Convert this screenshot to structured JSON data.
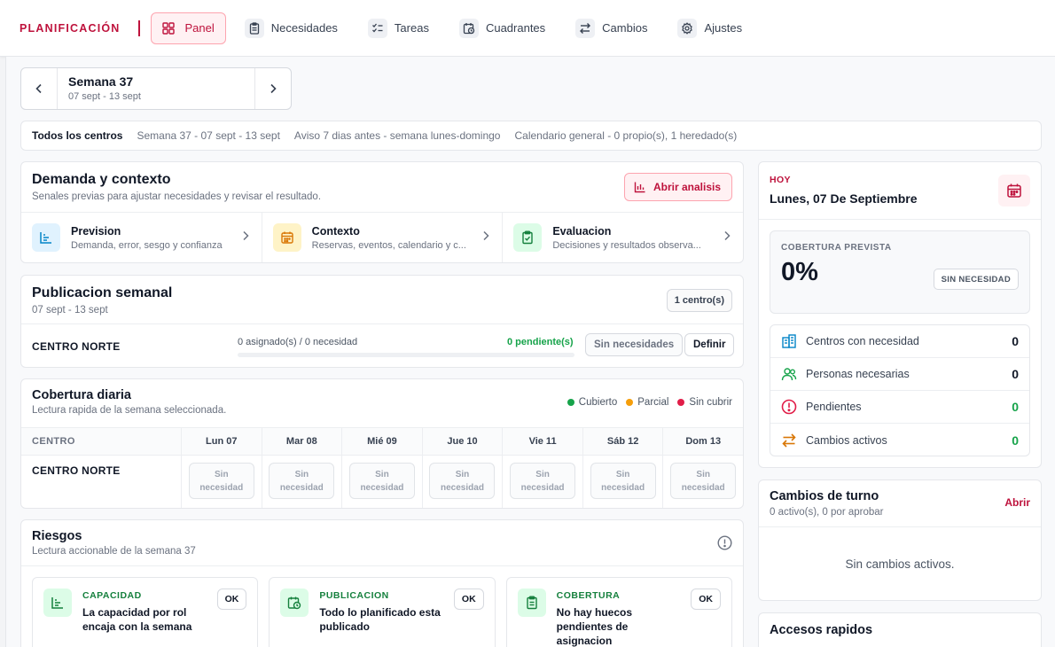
{
  "brand": "PLANIFICACIÓN",
  "nav": [
    {
      "label": "Panel",
      "icon": "dashboard-icon",
      "active": true
    },
    {
      "label": "Necesidades",
      "icon": "clipboard-icon"
    },
    {
      "label": "Tareas",
      "icon": "checklist-icon"
    },
    {
      "label": "Cuadrantes",
      "icon": "calendar-clock-icon"
    },
    {
      "label": "Cambios",
      "icon": "swap-icon"
    },
    {
      "label": "Ajustes",
      "icon": "gear-icon"
    }
  ],
  "week": {
    "title": "Semana 37",
    "range": "07 sept - 13 sept"
  },
  "filters": {
    "centers": "Todos los centros",
    "week": "Semana 37 - 07 sept - 13 sept",
    "notice": "Aviso 7 dias antes - semana lunes-domingo",
    "calendar": "Calendario general - 0 propio(s), 1 heredado(s)"
  },
  "demanda": {
    "title": "Demanda y contexto",
    "subtitle": "Senales previas para ajustar necesidades y revisar el resultado.",
    "button": "Abrir analisis",
    "items": [
      {
        "title": "Prevision",
        "desc": "Demanda, error, sesgo y confianza"
      },
      {
        "title": "Contexto",
        "desc": "Reservas, eventos, calendario y c..."
      },
      {
        "title": "Evaluacion",
        "desc": "Decisiones y resultados observa..."
      }
    ]
  },
  "publicacion": {
    "title": "Publicacion semanal",
    "subtitle": "07 sept - 13 sept",
    "count_badge": "1 centro(s)",
    "row": {
      "center": "CENTRO NORTE",
      "assigned": "0 asignado(s) / 0 necesidad",
      "pending": "0 pendiente(s)",
      "progress": 0,
      "btn_none": "Sin necesidades",
      "btn_define": "Definir"
    }
  },
  "cobertura": {
    "title": "Cobertura diaria",
    "subtitle": "Lectura rapida de la semana seleccionada.",
    "legend": [
      {
        "label": "Cubierto",
        "color": "#16a34a"
      },
      {
        "label": "Parcial",
        "color": "#f59e0b"
      },
      {
        "label": "Sin cubrir",
        "color": "#e11d48"
      }
    ],
    "col_center": "CENTRO",
    "days": [
      "Lun 07",
      "Mar 08",
      "Mié 09",
      "Jue 10",
      "Vie 11",
      "Sáb 12",
      "Dom 13"
    ],
    "row_center": "CENTRO NORTE",
    "cell_line1": "Sin",
    "cell_line2": "necesidad"
  },
  "riesgos": {
    "title": "Riesgos",
    "subtitle": "Lectura accionable de la semana 37",
    "cards": [
      {
        "kind": "CAPACIDAD",
        "text": "La capacidad por rol encaja con la semana",
        "badge": "OK"
      },
      {
        "kind": "PUBLICACION",
        "text": "Todo lo planificado esta publicado",
        "badge": "OK"
      },
      {
        "kind": "COBERTURA",
        "text": "No hay huecos pendientes de asignacion",
        "badge": "OK"
      }
    ]
  },
  "hoy": {
    "label": "HOY",
    "date": "Lunes, 07 De Septiembre",
    "coverage_label": "COBERTURA PREVISTA",
    "coverage_value": "0%",
    "coverage_tag": "SIN NECESIDAD",
    "stats": [
      {
        "label": "Centros con necesidad",
        "value": "0"
      },
      {
        "label": "Personas necesarias",
        "value": "0"
      },
      {
        "label": "Pendientes",
        "value": "0"
      },
      {
        "label": "Cambios activos",
        "value": "0"
      }
    ]
  },
  "cambios": {
    "title": "Cambios de turno",
    "subtitle": "0 activo(s), 0 por aprobar",
    "open": "Abrir",
    "empty": "Sin cambios activos."
  },
  "accesos": {
    "title": "Accesos rapidos"
  },
  "colors": {
    "accent": "#be123c",
    "success": "#16a34a",
    "warning": "#f59e0b",
    "danger": "#e11d48"
  }
}
